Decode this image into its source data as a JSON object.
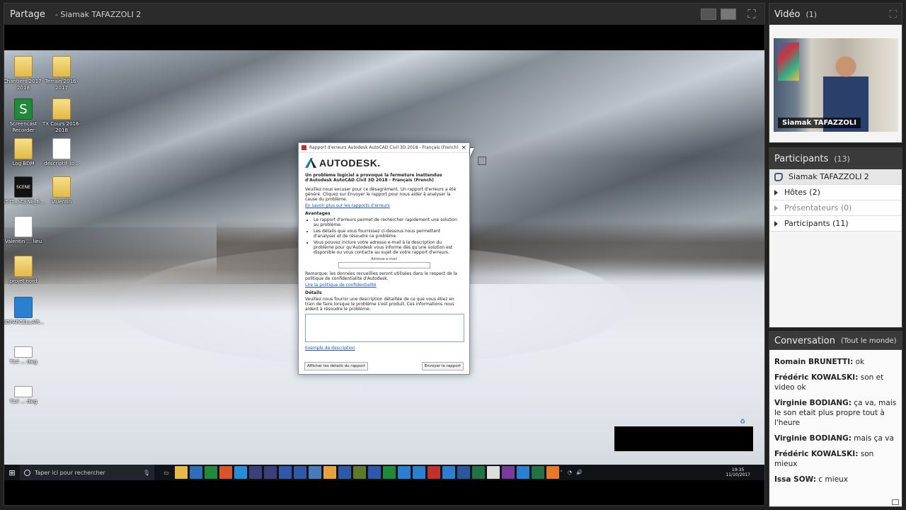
{
  "share": {
    "title": "Partage",
    "presenter": "- Siamak TAFAZZOLI 2"
  },
  "desktop": {
    "icons": [
      {
        "label": "Chantiers 2017-2018"
      },
      {
        "label": "Terrain 2016-2017"
      },
      {
        "label": "Screencast Recorder"
      },
      {
        "label": "TX Cours 2016-2018"
      },
      {
        "label": "Log BDM"
      },
      {
        "label": "descriptif_to..."
      },
      {
        "label": "E575_SCENE_6..."
      },
      {
        "label": "Valentin"
      },
      {
        "label": "Valentin ... lieu"
      },
      {
        "label": "projet nord"
      },
      {
        "label": "BDPARCELLAIR..."
      },
      {
        "label": "T14 ... dwg"
      },
      {
        "label": "T14 ... dwg"
      }
    ],
    "scene_label": "SCENE"
  },
  "dialog": {
    "title": "Rapport d'erreurs Autodesk AutoCAD Civil 3D 2018 - Français (French)",
    "brand": "AUTODESK.",
    "heading": "Un problème logiciel a provoqué la fermeture inattendue d'Autodesk AutoCAD Civil 3D 2018 - Français (French)",
    "intro": "Veuillez nous excuser pour ce désagrément. Un rapport d'erreurs a été généré. Cliquez sur Envoyer le rapport pour nous aider à analyser la cause du problème.",
    "learn_link": "En savoir plus sur les rapports d'erreurs",
    "advantages_title": "Avantages",
    "bullets": [
      "Le rapport d'erreurs permet de rechercher rapidement une solution au problème.",
      "Les détails que vous fournissez ci-dessous nous permettent d'analyser et de résoudre ce problème.",
      "Vous pouvez inclure votre adresse e-mail à la description du problème pour qu'Autodesk vous informe dès qu'une solution est disponible ou vous contacte au sujet de votre rapport d'erreurs."
    ],
    "email_label": "Adresse e-mail",
    "email_value": "",
    "privacy_note": "Remarque: les données recueillies seront utilisées dans le respect de la politique de confidentialité d'Autodesk.",
    "privacy_link": "Lire la politique de confidentialité",
    "details_title": "Détails",
    "details_text": "Veuillez nous fournir une description détaillée de ce que vous étiez en train de faire lorsque le problème s'est produit. Ces informations nous aident à résoudre le problème:",
    "details_value": "",
    "example_link": "Exemple de description",
    "btn_details": "Afficher les détails du rapport",
    "btn_send": "Envoyer le rapport",
    "close_glyph": "×"
  },
  "taskbar": {
    "search_placeholder": "Taper ici pour rechercher",
    "time": "19:35",
    "date": "11/10/2017"
  },
  "video": {
    "title": "Vidéo",
    "count": "(1)",
    "participant_name": "Siamak TAFAZZOLI"
  },
  "participants": {
    "title": "Participants",
    "count": "(13)",
    "me": "Siamak TAFAZZOLI 2",
    "groups": [
      {
        "label": "Hôtes (2)",
        "enabled": true
      },
      {
        "label": "Présentateurs (0)",
        "enabled": false
      },
      {
        "label": "Participants (11)",
        "enabled": true
      }
    ]
  },
  "chat": {
    "title": "Conversation",
    "scope": "(Tout le monde)",
    "messages": [
      {
        "author": "Romain BRUNETTI:",
        "text": " ok"
      },
      {
        "author": "Frédéric KOWALSKI:",
        "text": " son et video ok"
      },
      {
        "author": "Virginie BODIANG:",
        "text": " ça va, mais le son etait plus propre tout à l'heure"
      },
      {
        "author": "Virginie BODIANG:",
        "text": " mais ça va"
      },
      {
        "author": "Frédéric KOWALSKI:",
        "text": " son mieux"
      },
      {
        "author": "Issa SOW:",
        "text": " c mieux"
      }
    ]
  },
  "colors": {
    "header_bg": "#2b2b2b",
    "link": "#1a55c8",
    "autodesk_red": "#c0322e"
  }
}
